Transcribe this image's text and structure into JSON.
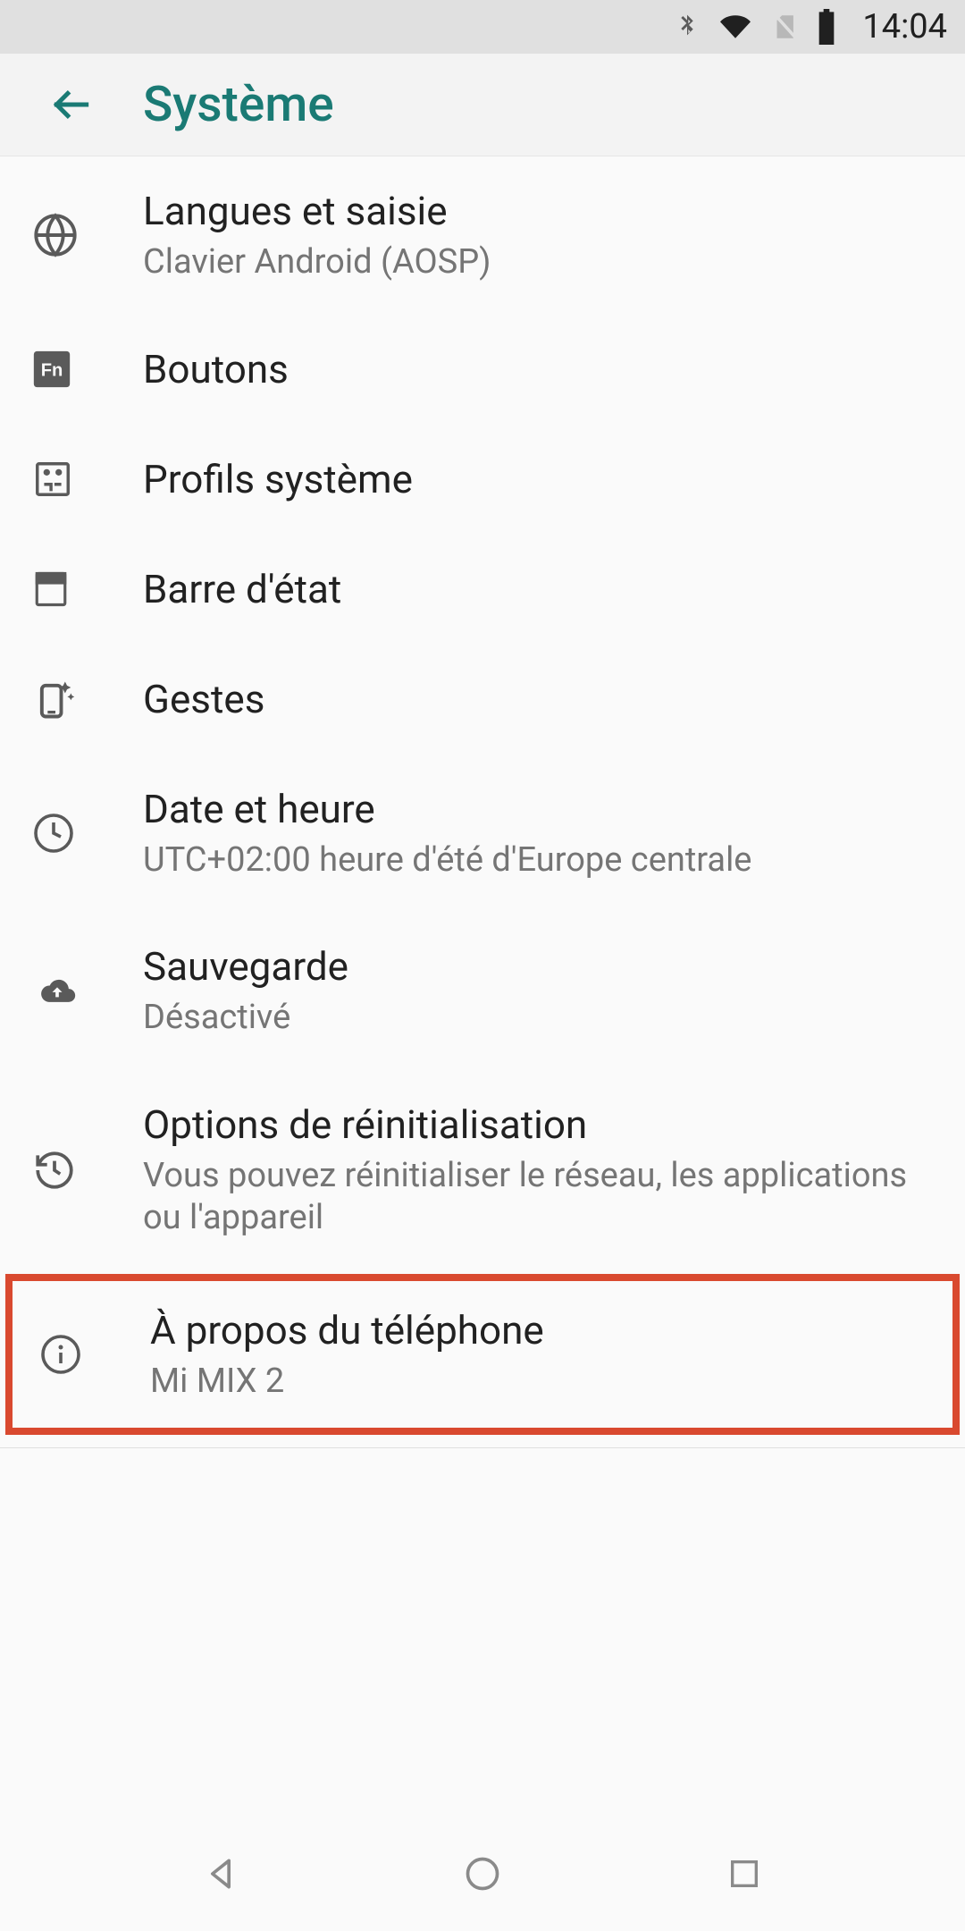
{
  "status": {
    "time": "14:04"
  },
  "header": {
    "title": "Système"
  },
  "items": [
    {
      "title": "Langues et saisie",
      "sub": "Clavier Android (AOSP)"
    },
    {
      "title": "Boutons"
    },
    {
      "title": "Profils système"
    },
    {
      "title": "Barre d'état"
    },
    {
      "title": "Gestes"
    },
    {
      "title": "Date et heure",
      "sub": "UTC+02:00 heure d'été d'Europe centrale"
    },
    {
      "title": "Sauvegarde",
      "sub": "Désactivé"
    },
    {
      "title": "Options de réinitialisation",
      "sub": "Vous pouvez réinitialiser le réseau, les applications ou l'appareil"
    },
    {
      "title": "À propos du téléphone",
      "sub": "Mi MIX 2"
    }
  ]
}
